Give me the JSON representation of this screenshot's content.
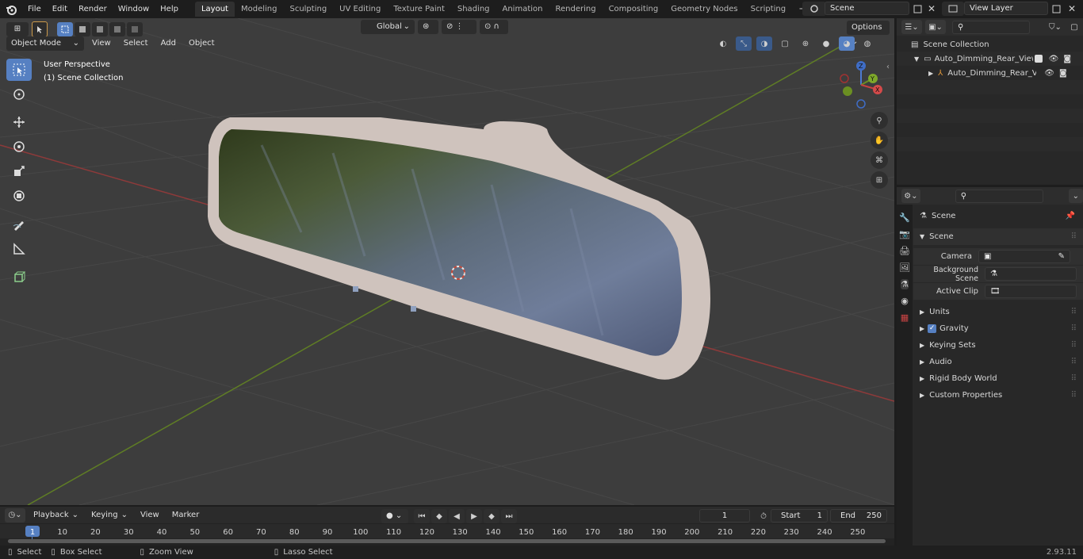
{
  "menus": [
    "File",
    "Edit",
    "Render",
    "Window",
    "Help"
  ],
  "workspaces": [
    "Layout",
    "Modeling",
    "Sculpting",
    "UV Editing",
    "Texture Paint",
    "Shading",
    "Animation",
    "Rendering",
    "Compositing",
    "Geometry Nodes",
    "Scripting"
  ],
  "active_workspace": "Layout",
  "scene_name": "Scene",
  "view_layer": "View Layer",
  "viewport": {
    "mode": "Object Mode",
    "menu": [
      "View",
      "Select",
      "Add",
      "Object"
    ],
    "transform_orientation": "Global",
    "options_label": "Options",
    "overlay_line1": "User Perspective",
    "overlay_line2": "(1) Scene Collection",
    "gizmo_axes": [
      "Z",
      "Y",
      "X"
    ]
  },
  "outliner": {
    "root": "Scene Collection",
    "items": [
      {
        "label": "Auto_Dimming_Rear_View_M"
      },
      {
        "label": "Auto_Dimming_Rear_Vie"
      }
    ]
  },
  "properties": {
    "header": "Scene",
    "panel": "Scene",
    "fields": [
      {
        "label": "Camera"
      },
      {
        "label": "Background Scene"
      },
      {
        "label": "Active Clip"
      }
    ],
    "sections": [
      "Units",
      "Gravity",
      "Keying Sets",
      "Audio",
      "Rigid Body World",
      "Custom Properties"
    ]
  },
  "timeline": {
    "menus": [
      "Playback",
      "Keying",
      "View",
      "Marker"
    ],
    "current_frame": "1",
    "start_label": "Start",
    "start": "1",
    "end_label": "End",
    "end": "250",
    "ticks": [
      "1",
      "10",
      "20",
      "30",
      "40",
      "50",
      "60",
      "70",
      "80",
      "90",
      "100",
      "110",
      "120",
      "130",
      "140",
      "150",
      "160",
      "170",
      "180",
      "190",
      "200",
      "210",
      "220",
      "230",
      "240",
      "250"
    ]
  },
  "statusbar": {
    "select": "Select",
    "box_select": "Box Select",
    "zoom_view": "Zoom View",
    "lasso_select": "Lasso Select",
    "version": "2.93.11"
  },
  "colors": {
    "accent": "#5680c2",
    "x_axis": "#a23c3c",
    "y_axis": "#6a8a2a",
    "mirror_frame": "#cfc3bd"
  }
}
